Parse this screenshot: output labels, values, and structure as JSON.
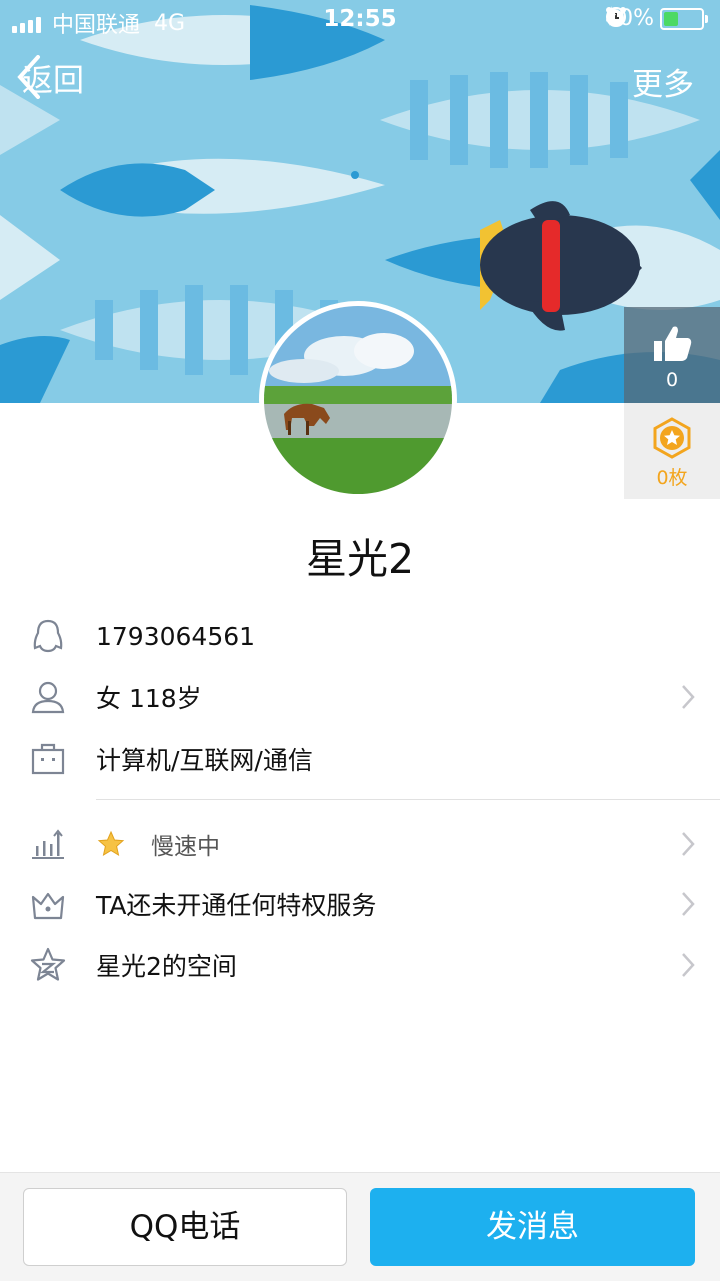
{
  "status_bar": {
    "carrier": "中国联通",
    "network": "4G",
    "time": "12:55",
    "battery": "40%",
    "battery_level": 0.4
  },
  "nav": {
    "back_label": "返回",
    "more_label": "更多"
  },
  "side": {
    "like_count": "0",
    "coin_count": "0枚"
  },
  "profile": {
    "nickname": "星光2",
    "qq_number": "1793064561",
    "gender_age": "女 118岁",
    "occupation": "计算机/互联网/通信",
    "level_status": "慢速中",
    "privilege": "TA还未开通任何特权服务",
    "space": "星光2的空间"
  },
  "actions": {
    "call_label": "QQ电话",
    "message_label": "发消息"
  },
  "colors": {
    "accent": "#1db0ef",
    "cover_bg": "#86cbe6",
    "coin": "#f3a51e"
  }
}
